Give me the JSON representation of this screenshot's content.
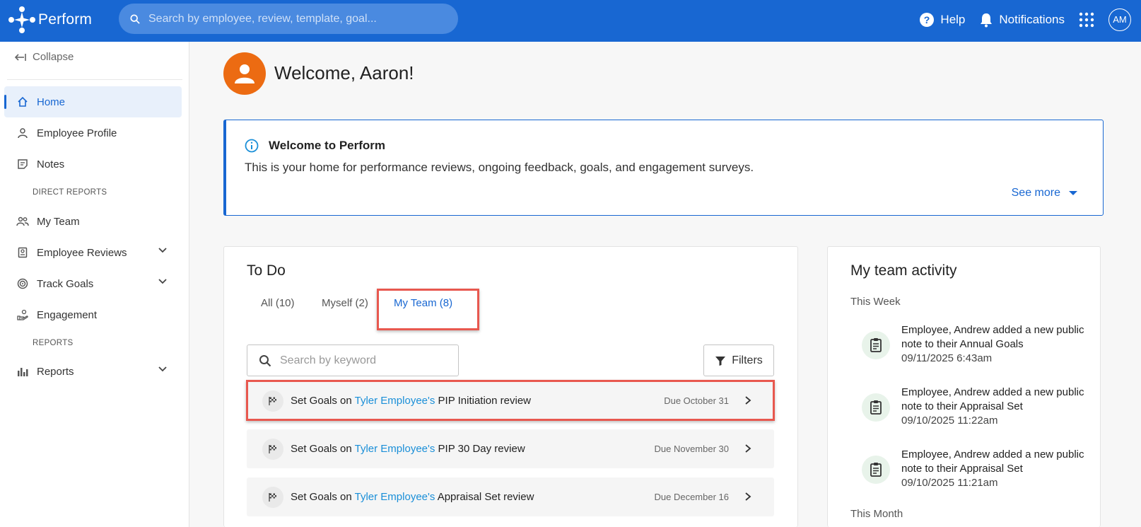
{
  "app": {
    "name": "Perform"
  },
  "search": {
    "placeholder": "Search by employee, review, template, goal..."
  },
  "topbar": {
    "help_label": "Help",
    "notifications_label": "Notifications",
    "avatar_initials": "AM"
  },
  "sidebar": {
    "collapse_label": "Collapse",
    "items": [
      {
        "label": "Home",
        "icon": "home-icon",
        "active": true
      },
      {
        "label": "Employee Profile",
        "icon": "person-icon"
      },
      {
        "label": "Notes",
        "icon": "note-icon"
      },
      {
        "label": "My Team",
        "icon": "team-icon"
      },
      {
        "label": "Employee Reviews",
        "icon": "review-icon",
        "expandable": true
      },
      {
        "label": "Track Goals",
        "icon": "target-icon",
        "expandable": true
      },
      {
        "label": "Engagement",
        "icon": "engagement-icon"
      },
      {
        "label": "Reports",
        "icon": "bar-chart-icon",
        "expandable": true
      }
    ],
    "sections": {
      "direct_reports": "DIRECT REPORTS",
      "reports": "REPORTS"
    }
  },
  "welcome": {
    "title": "Welcome, Aaron!"
  },
  "banner": {
    "title": "Welcome to Perform",
    "text": "This is your home for performance reviews, ongoing feedback, goals, and engagement surveys.",
    "see_more": "See more"
  },
  "todo": {
    "title": "To Do",
    "tabs": [
      {
        "label": "All (10)"
      },
      {
        "label": "Myself (2)"
      },
      {
        "label": "My Team (8)",
        "active": true
      }
    ],
    "search_placeholder": "Search by keyword",
    "filters_label": "Filters",
    "rows": [
      {
        "prefix": "Set Goals on ",
        "link": "Tyler Employee's",
        "suffix": " PIP Initiation review",
        "due": "Due October 31"
      },
      {
        "prefix": "Set Goals on ",
        "link": "Tyler Employee's",
        "suffix": " PIP 30 Day review",
        "due": "Due November 30"
      },
      {
        "prefix": "Set Goals on ",
        "link": "Tyler Employee's",
        "suffix": " Appraisal Set review",
        "due": "Due December 16"
      }
    ]
  },
  "activity": {
    "title": "My team activity",
    "this_week": "This Week",
    "this_month": "This Month",
    "items": [
      {
        "text": "Employee, Andrew added a new public note to their Annual Goals",
        "time": "09/11/2025 6:43am"
      },
      {
        "text": "Employee, Andrew added a new public note to their Appraisal Set",
        "time": "09/10/2025 11:22am"
      },
      {
        "text": "Employee, Andrew added a new public note to their Appraisal Set",
        "time": "09/10/2025 11:21am"
      }
    ]
  },
  "colors": {
    "brand": "#1867d2",
    "avatar_orange": "#ec6b12",
    "highlight": "#e8584f",
    "link": "#1a8fd8"
  }
}
